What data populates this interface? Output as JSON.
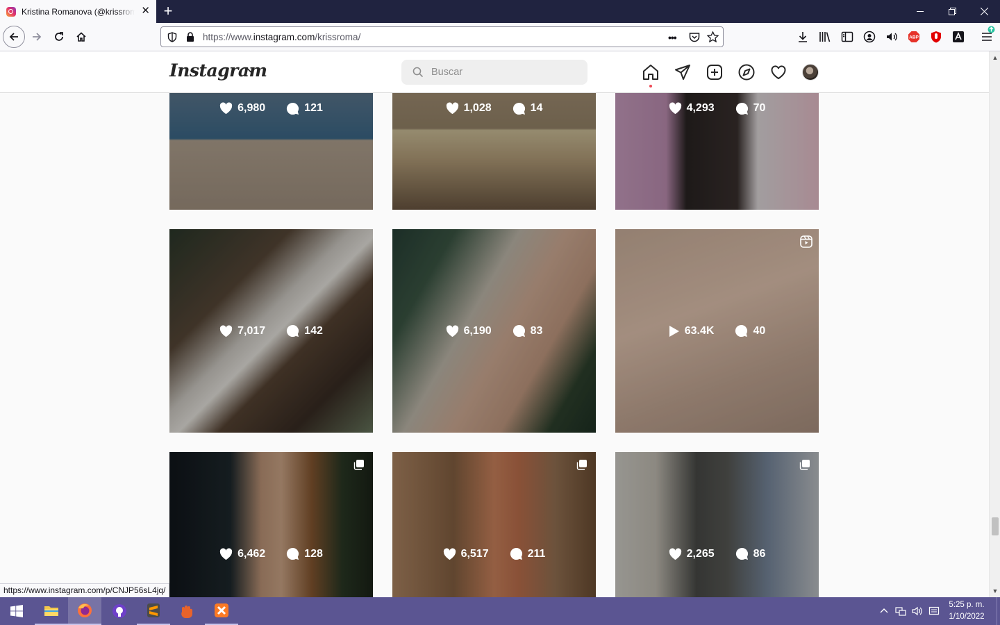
{
  "browser": {
    "tab_title": "Kristina Romanova (@krissroma) • Instagram photos and videos",
    "url_prefix": "https://www.",
    "url_host": "instagram.com",
    "url_path": "/krissroma/",
    "status_link": "https://www.instagram.com/p/CNJP56sL4jq/"
  },
  "instagram": {
    "logo": "Instagram",
    "search_placeholder": "Buscar"
  },
  "posts": [
    {
      "likes": "6,980",
      "comments": "121",
      "type": "photo"
    },
    {
      "likes": "1,028",
      "comments": "14",
      "type": "photo"
    },
    {
      "likes": "4,293",
      "comments": "70",
      "type": "photo"
    },
    {
      "likes": "7,017",
      "comments": "142",
      "type": "photo"
    },
    {
      "likes": "6,190",
      "comments": "83",
      "type": "photo"
    },
    {
      "views": "63.4K",
      "comments": "40",
      "type": "reel"
    },
    {
      "likes": "6,462",
      "comments": "128",
      "type": "carousel"
    },
    {
      "likes": "6,517",
      "comments": "211",
      "type": "carousel"
    },
    {
      "likes": "2,265",
      "comments": "86",
      "type": "carousel"
    }
  ],
  "taskbar": {
    "time": "5:25 p. m.",
    "date": "1/10/2022"
  },
  "colors": {
    "titlebar": "#202340",
    "taskbar": "#5b5592",
    "notification_dot": "#ed4956"
  }
}
